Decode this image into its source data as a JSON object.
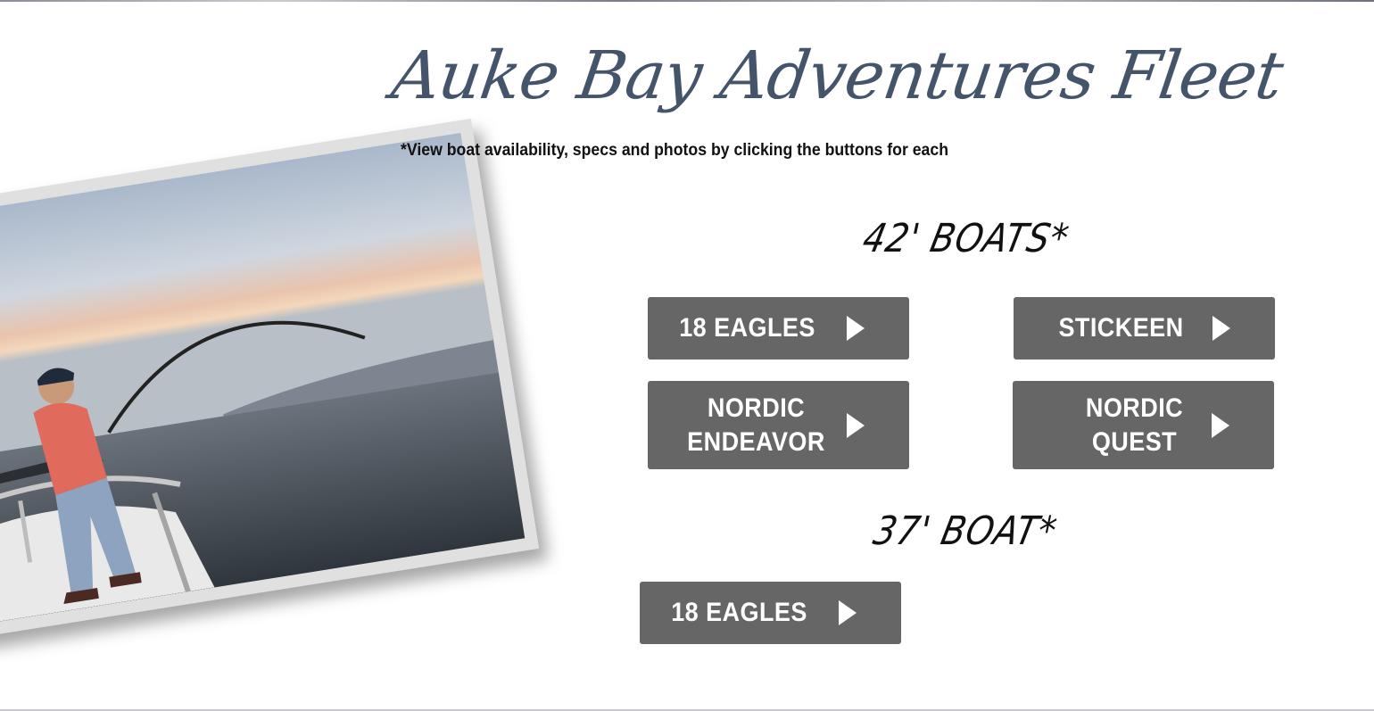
{
  "page": {
    "title": "Auke Bay Adventures Fleet",
    "subtitle": "*View boat availability, specs and photos by clicking the buttons for each"
  },
  "photo": {
    "subject": "fisherman-on-boat-image"
  },
  "sections": [
    {
      "heading": "42' BOATS*",
      "buttons": [
        {
          "label": "18 EAGLES",
          "icon": "play-arrow-icon"
        },
        {
          "label": "STICKEEN",
          "icon": "play-arrow-icon"
        },
        {
          "label": "NORDIC\nENDEAVOR",
          "icon": "play-arrow-icon"
        },
        {
          "label": "NORDIC\nQUEST",
          "icon": "play-arrow-icon"
        }
      ]
    },
    {
      "heading": "37' BOAT*",
      "buttons": [
        {
          "label": "18 EAGLES",
          "icon": "play-arrow-icon"
        }
      ]
    }
  ],
  "colors": {
    "title": "#44546a",
    "button_bg": "#666666",
    "button_text": "#ffffff",
    "heading": "#111111"
  }
}
